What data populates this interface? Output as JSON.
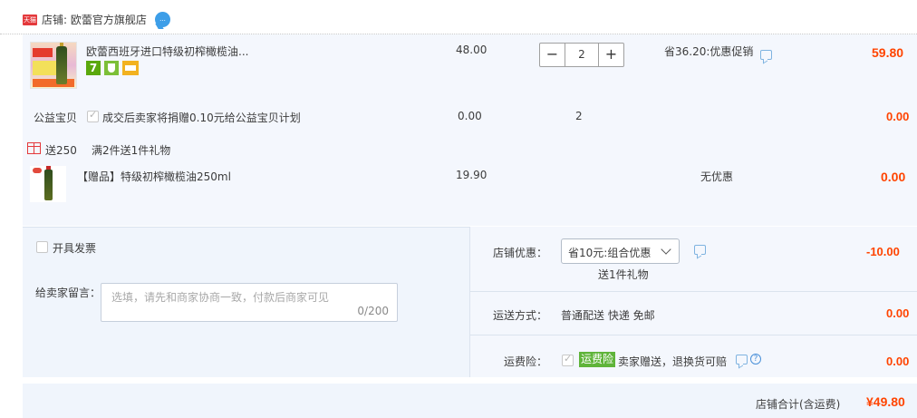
{
  "shop": {
    "badge": "天猫",
    "label": "店铺: 欧蕾官方旗舰店",
    "chat": "...",
    "brand_color": "#e4393c"
  },
  "item1": {
    "title": "欧蕾西班牙进口特级初榨橄榄油...",
    "service_icons": [
      "seven-day-return-icon",
      "shield-icon",
      "card-icon"
    ],
    "service_7": "7",
    "price": "48.00",
    "qty_minus": "−",
    "qty": "2",
    "qty_plus": "+",
    "promo": "省36.20:优惠促销",
    "subtotal": "59.80"
  },
  "charity": {
    "label": "公益宝贝",
    "text": "成交后卖家将捐赠0.10元给公益宝贝计划",
    "price": "0.00",
    "qty": "2",
    "subtotal": "0.00"
  },
  "gift": {
    "label": "送250",
    "rule": "满2件送1件礼物"
  },
  "item2": {
    "title": "【赠品】特级初榨橄榄油250ml",
    "price": "19.90",
    "promo": "无优惠",
    "subtotal": "0.00"
  },
  "invoice": {
    "label": "开具发票"
  },
  "message": {
    "label": "给卖家留言：",
    "placeholder": "选填，请先和商家协商一致，付款后商家可见",
    "count": "0/200"
  },
  "coupon": {
    "label": "店铺优惠：",
    "selected": "省10元:组合优惠",
    "gift": "送1件礼物",
    "subtotal": "-10.00"
  },
  "shipping": {
    "label": "运送方式：",
    "value": "普通配送 快递 免邮",
    "subtotal": "0.00"
  },
  "insurance": {
    "label": "运费险：",
    "badge": "运费险",
    "text": "卖家赠送，退换货可赔",
    "help": "?",
    "subtotal": "0.00",
    "badge_color": "#5fb43a"
  },
  "total": {
    "label": "店铺合计(含运费)",
    "value": "¥49.80",
    "price_color": "#ff4400"
  }
}
